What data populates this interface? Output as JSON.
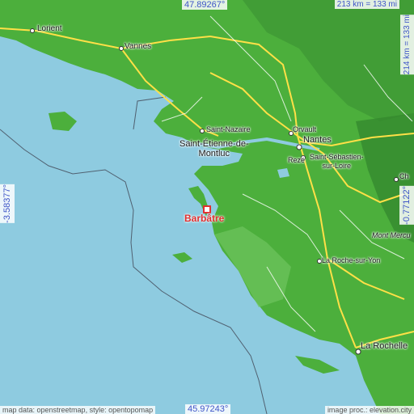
{
  "coords": {
    "top": "47.89267°",
    "bottom": "45.97243°",
    "left": "-3.58377°",
    "right": "-0.77122°"
  },
  "scale": {
    "horizontal": "213 km = 133 mi",
    "vertical": "214 km = 133 mi"
  },
  "credits": {
    "left": "map data: openstreetmap, style: opentopomap",
    "right": "image proc.: elevation.city"
  },
  "target": {
    "name": "Barbâtre",
    "marker_color": "#e03030"
  },
  "places": {
    "lorient": "Lorient",
    "vannes": "Vannes",
    "saint_nazaire": "Saint-Nazaire",
    "orvault": "Orvault",
    "nantes": "Nantes",
    "saint_etienne": "Saint-Étienne-de-\nMontluc",
    "reze": "Rezé",
    "saint_sebastien": "Saint-Sébastien-\nsur-Loire",
    "la_roche": "La Roche-sur-Yon",
    "mont_mercure": "Mont Mercu",
    "la_rochelle": "La Rochelle",
    "cholet": "Ch"
  },
  "colors": {
    "sea": "#8ecbe0",
    "land_low": "#4caf3c",
    "land_high": "#2f7f2a",
    "road_major": "#ffe047",
    "road_minor": "#ffffff"
  }
}
